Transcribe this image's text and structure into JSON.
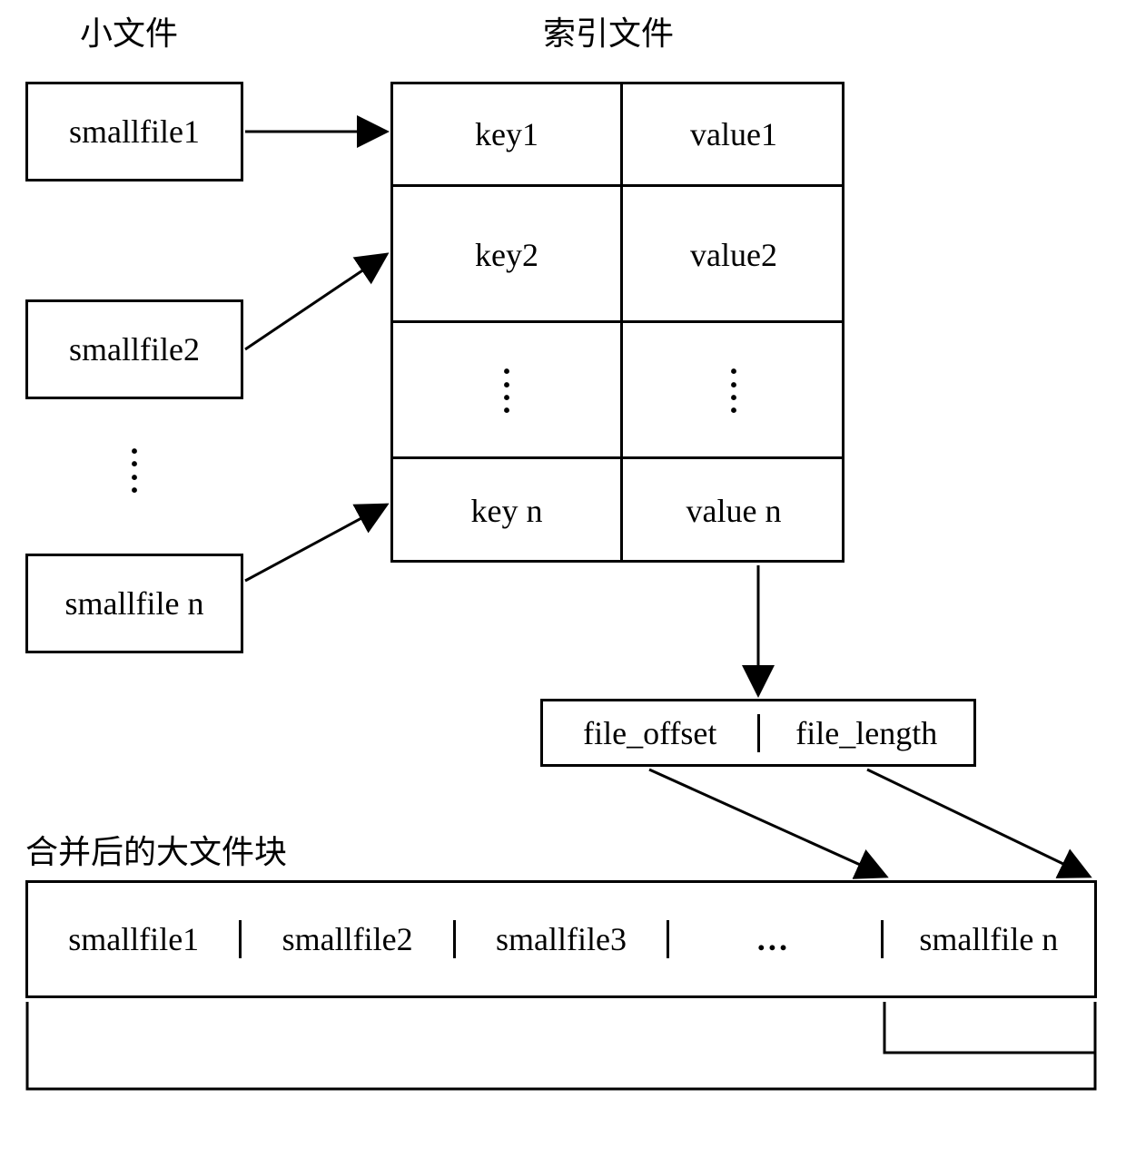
{
  "labels": {
    "smallFiles": "小文件",
    "indexFile": "索引文件",
    "mergedBlock": "合并后的大文件块"
  },
  "smallFiles": {
    "file1": "smallfile1",
    "file2": "smallfile2",
    "fileN": "smallfile n"
  },
  "indexTable": {
    "row1Key": "key1",
    "row1Val": "value1",
    "row2Key": "key2",
    "row2Val": "value2",
    "rowNKey": "key n",
    "rowNVal": "value n"
  },
  "valueBox": {
    "offset": "file_offset",
    "length": "file_length"
  },
  "mergedCells": {
    "c1": "smallfile1",
    "c2": "smallfile2",
    "c3": "smallfile3",
    "c4": "…",
    "c5": "smallfile n"
  }
}
